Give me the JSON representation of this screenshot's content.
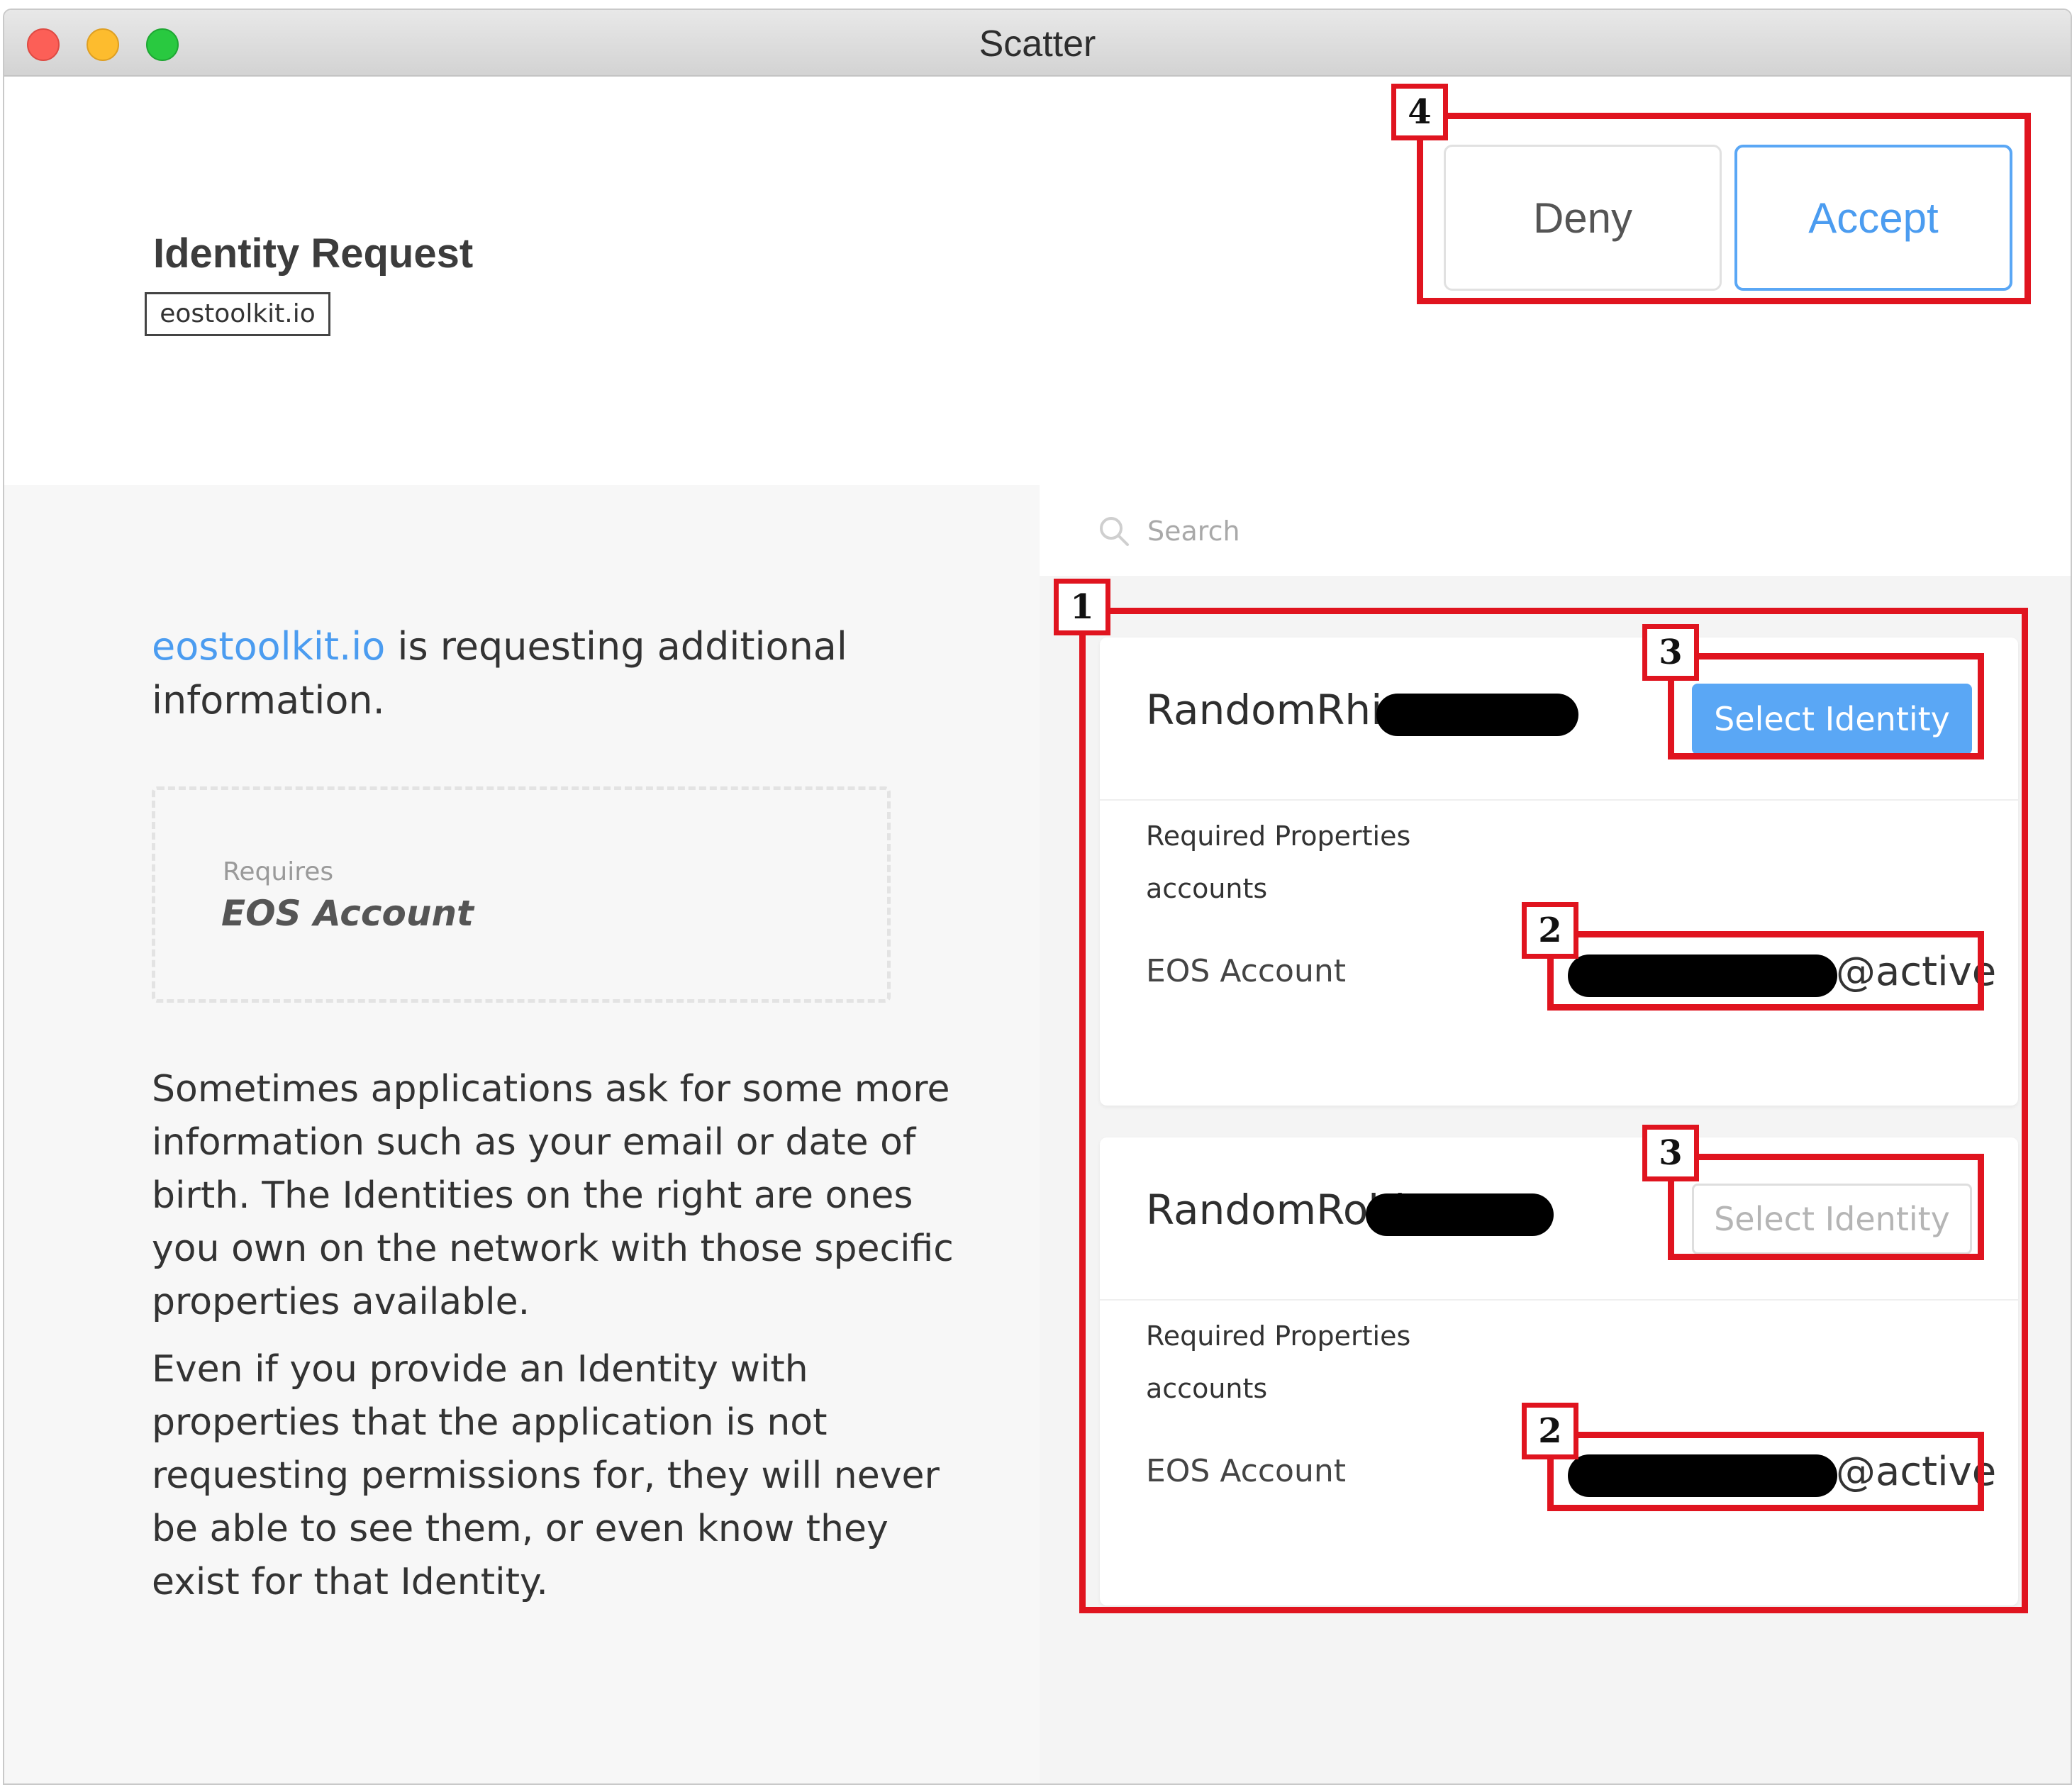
{
  "window": {
    "title": "Scatter"
  },
  "header": {
    "title": "Identity Request",
    "domain": "eostoolkit.io",
    "deny_label": "Deny",
    "accept_label": "Accept"
  },
  "left": {
    "request_domain": "eostoolkit.io",
    "request_text": " is requesting additional information.",
    "requires_label": "Requires",
    "requires_value": "EOS Account",
    "paragraph1": "Sometimes applications ask for some more information such as your email or date of birth. The Identities on the right are ones you own on the network with those specific properties available.",
    "paragraph2": "Even if you provide an Identity with properties that the application is not requesting permissions for, they will never be able to see them, or even know they exist for that Identity."
  },
  "search": {
    "placeholder": "Search"
  },
  "identities": [
    {
      "name": "RandomRhino",
      "select_label": "Select Identity",
      "required_properties_label": "Required Properties",
      "property_key": "accounts",
      "account_label": "EOS Account",
      "account_suffix": "@active"
    },
    {
      "name": "RandomRobin",
      "select_label": "Select Identity",
      "required_properties_label": "Required Properties",
      "property_key": "accounts",
      "account_label": "EOS Account",
      "account_suffix": "@active"
    }
  ],
  "annotations": [
    "1",
    "2",
    "3",
    "4"
  ],
  "colors": {
    "accent": "#5aa7f5",
    "annotation": "#e0141f",
    "redaction": "#000000"
  }
}
